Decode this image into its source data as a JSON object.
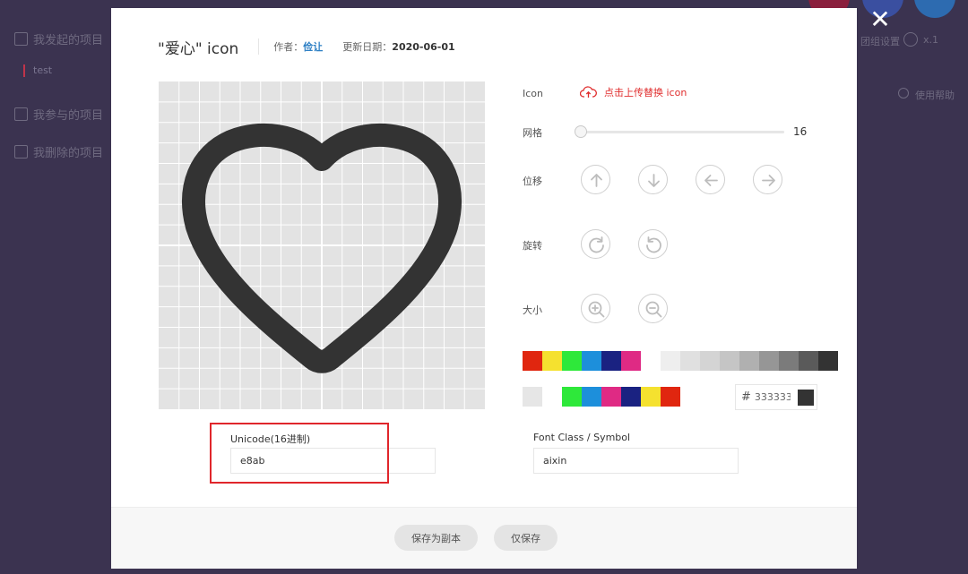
{
  "background": {
    "sidebar": {
      "items": [
        {
          "label": "我发起的项目",
          "icon": "project-icon"
        },
        {
          "label": "我参与的项目",
          "icon": "project-icon"
        },
        {
          "label": "我删除的项目",
          "icon": "trash-icon"
        }
      ],
      "sub_item": "test"
    },
    "right": {
      "header_text": "团组设置",
      "version": "x.1",
      "help": "使用帮助"
    }
  },
  "dialog": {
    "title": "\"爱心\" icon",
    "author_label": "作者：",
    "author": "俭让",
    "date_label": "更新日期：",
    "date": "2020-06-01",
    "close_icon": "close-icon"
  },
  "controls": {
    "icon_label": "Icon",
    "upload_label": "点击上传替换 icon",
    "grid_label": "网格",
    "grid_value": "16",
    "grid_level_fraction": 0,
    "move_label": "位移",
    "move_buttons": [
      "arrow-up-icon",
      "arrow-down-icon",
      "arrow-left-icon",
      "arrow-right-icon"
    ],
    "rotate_label": "旋转",
    "rotate_buttons": [
      "rotate-clockwise-icon",
      "rotate-counterclockwise-icon"
    ],
    "size_label": "大小",
    "size_buttons": [
      "zoom-in-icon",
      "zoom-out-icon"
    ]
  },
  "palette": {
    "row1_colors": [
      "#e0260f",
      "#f5e12f",
      "#2ee83a",
      "#1d8fdb",
      "#1a2281",
      "#df2a84"
    ],
    "row1_grays": [
      "#eeeeee",
      "#e0e0e0",
      "#d4d4d4",
      "#c5c5c5",
      "#b0b0b0",
      "#969696",
      "#7b7b7b",
      "#5a5a5a",
      "#333333"
    ],
    "row2_first": "#e6e6e6",
    "row2_colors": [
      "#2ee83a",
      "#1d8fdb",
      "#df2a84",
      "#1a2281",
      "#f5e12f",
      "#e0260f"
    ],
    "hex_hash": "#",
    "hex_value": "333333",
    "current_color": "#333333"
  },
  "fields": {
    "unicode_label": "Unicode(16进制)",
    "unicode_value": "e8ab",
    "fontclass_label": "Font Class / Symbol",
    "fontclass_value": "aixin"
  },
  "footer": {
    "save_copy": "保存为副本",
    "save_only": "仅保存"
  },
  "colors": {
    "accent_red": "#e0262b",
    "author_blue": "#2d7fc4",
    "icon_stroke": "#333333"
  }
}
